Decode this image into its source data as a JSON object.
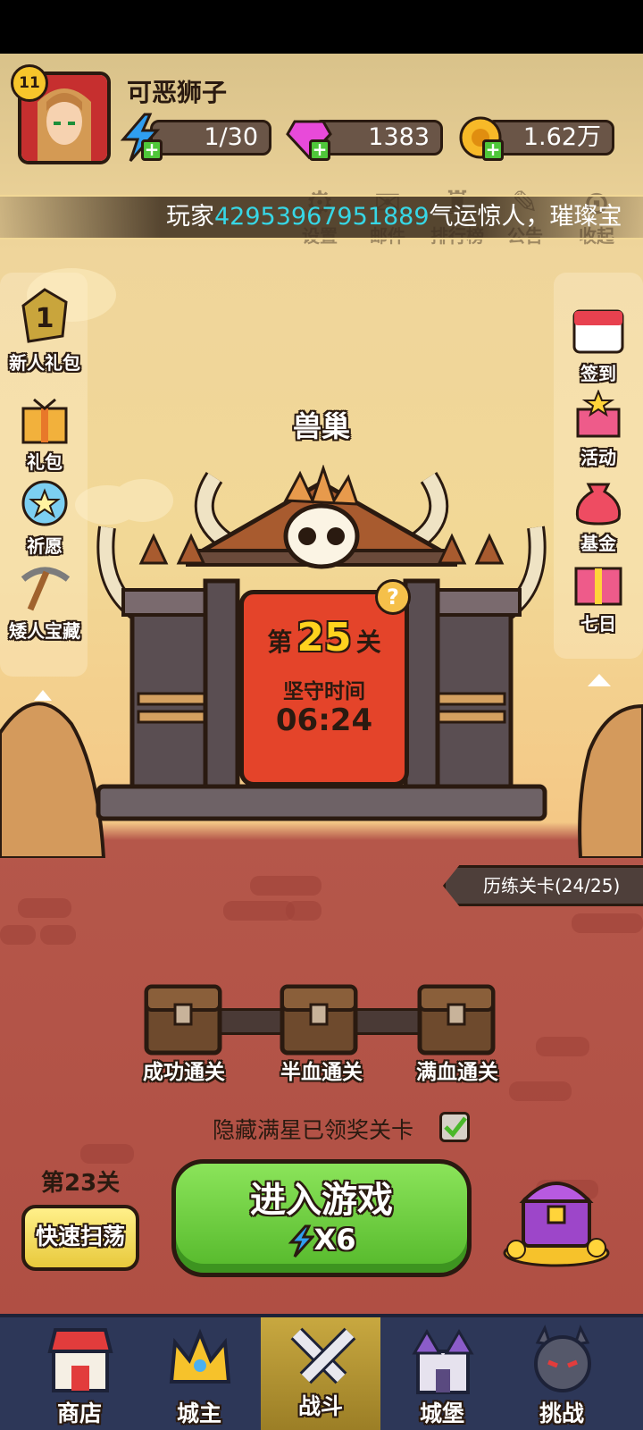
{
  "player": {
    "level": "11",
    "name": "可恶狮子"
  },
  "resources": {
    "energy": "1/30",
    "gems": "1383",
    "gold": "1.62万"
  },
  "ticker": {
    "prefix": "玩家",
    "player_id": "42953967951889",
    "suffix": "气运惊人，璀璨宝"
  },
  "top_menu": [
    "设置",
    "邮件",
    "排行榜",
    "公告",
    "收起"
  ],
  "left_menu": [
    {
      "label": "新人礼包",
      "icon": "newbie-pack-icon",
      "badge": "1"
    },
    {
      "label": "礼包",
      "icon": "gift-icon"
    },
    {
      "label": "祈愿",
      "icon": "wish-icon"
    },
    {
      "label": "矮人宝藏",
      "icon": "pickaxe-icon"
    }
  ],
  "right_menu": [
    {
      "label": "签到",
      "icon": "calendar-icon"
    },
    {
      "label": "活动",
      "icon": "activity-icon"
    },
    {
      "label": "基金",
      "icon": "money-bag-icon"
    },
    {
      "label": "七日",
      "icon": "seven-day-gift-icon"
    }
  ],
  "stage": {
    "title": "兽巢",
    "prefix": "第",
    "number": "25",
    "suffix": "关",
    "hold_label": "坚守时间",
    "hold_time": "06:24"
  },
  "training": "历练关卡(24/25)",
  "chests": [
    "成功通关",
    "半血通关",
    "满血通关"
  ],
  "hide_option": {
    "label": "隐藏满星已领奖关卡",
    "checked": true
  },
  "sweep": {
    "stage": "第23关",
    "button": "快速扫荡"
  },
  "play": {
    "label": "进入游戏",
    "cost": "X6"
  },
  "nav": [
    {
      "label": "商店",
      "icon": "shop-icon",
      "active": false
    },
    {
      "label": "城主",
      "icon": "crown-icon",
      "active": false
    },
    {
      "label": "战斗",
      "icon": "crossed-swords-icon",
      "active": true
    },
    {
      "label": "城堡",
      "icon": "castle-icon",
      "active": false
    },
    {
      "label": "挑战",
      "icon": "demon-helmet-icon",
      "active": false
    }
  ],
  "colors": {
    "accent_green": "#55b82b",
    "gold": "#ffd21e",
    "board_red": "#e4442a",
    "ticker_highlight": "#37d7e6",
    "nav_bg": "#2d3758"
  }
}
